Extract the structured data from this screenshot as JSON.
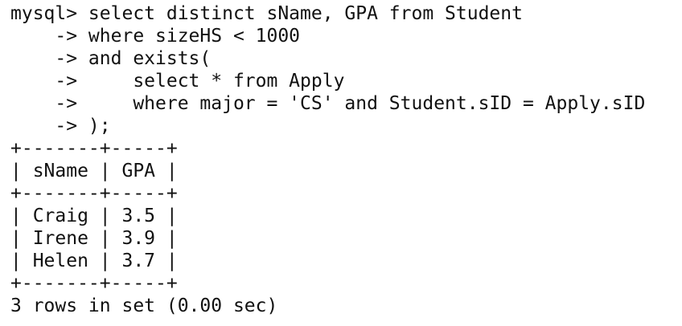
{
  "terminal": {
    "lines": [
      "mysql> select distinct sName, GPA from Student",
      "    -> where sizeHS < 1000",
      "    -> and exists(",
      "    ->     select * from Apply",
      "    ->     where major = 'CS' and Student.sID = Apply.sID",
      "    -> );",
      "+-------+-----+",
      "| sName | GPA |",
      "+-------+-----+",
      "| Craig | 3.5 |",
      "| Irene | 3.9 |",
      "| Helen | 3.7 |",
      "+-------+-----+",
      "3 rows in set (0.00 sec)"
    ]
  },
  "colors": {
    "background": "#ffffff",
    "text": "#111111"
  }
}
